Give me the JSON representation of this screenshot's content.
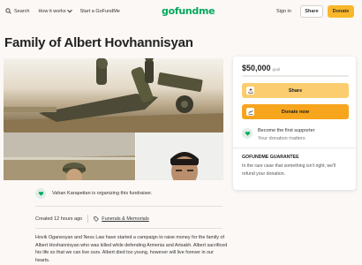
{
  "nav": {
    "search_label": "Search",
    "how_label": "How it works",
    "start_label": "Start a GoFundMe",
    "logo": "gofundme",
    "signin_label": "Sign in",
    "share_label": "Share",
    "donate_label": "Donate"
  },
  "title": "Family of Albert Hovhannisyan",
  "organizer": {
    "text": "Vahan Karapetian is organizing this fundraiser."
  },
  "meta": {
    "created": "Created 12 hours ago",
    "category": "Funerals & Memorials"
  },
  "story": "Hovik Oganesyan and Ness Law have started a campaign to raise money for the family of Albert Hovhannisyan who was killed while defending Armenia and Artsakh.  Albert sacrificed his life so that we can live ours.  Albert died too young, however will live forever in our hearts.",
  "card": {
    "goal_amount": "$50,000",
    "goal_suffix": "goal",
    "progress_fraction": 0,
    "share_label": "Share",
    "donate_label": "Donate now",
    "first_title": "Become the first supporter",
    "first_sub": "Your donation matters",
    "guarantee_title": "GOFUNDME GUARANTEE",
    "guarantee_text": "In the rare case that something isn't right, we'll refund your donation."
  },
  "colors": {
    "brand_green": "#02a95c",
    "donate_yellow": "#f7a51d",
    "share_yellow": "#fbcd6e"
  },
  "icons": [
    "search-icon",
    "chevron-down-icon",
    "share-icon",
    "heart-hand-icon",
    "tag-icon",
    "hands-icon"
  ]
}
